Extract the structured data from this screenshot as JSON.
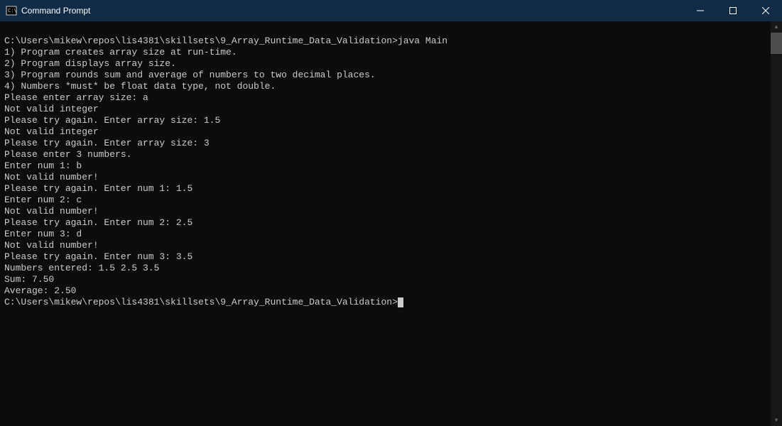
{
  "window": {
    "title": "Command Prompt"
  },
  "terminal": {
    "lines": [
      "C:\\Users\\mikew\\repos\\lis4381\\skillsets\\9_Array_Runtime_Data_Validation>java Main",
      "1) Program creates array size at run-time.",
      "2) Program displays array size.",
      "3) Program rounds sum and average of numbers to two decimal places.",
      "4) Numbers *must* be float data type, not double.",
      "",
      "Please enter array size: a",
      "Not valid integer",
      "",
      "Please try again. Enter array size: 1.5",
      "Not valid integer",
      "",
      "Please try again. Enter array size: 3",
      "",
      "Please enter 3 numbers.",
      "Enter num 1: b",
      "Not valid number!",
      "Please try again. Enter num 1: 1.5",
      "Enter num 2: c",
      "Not valid number!",
      "Please try again. Enter num 2: 2.5",
      "Enter num 3: d",
      "Not valid number!",
      "Please try again. Enter num 3: 3.5",
      "",
      "Numbers entered: 1.5 2.5 3.5",
      "Sum: 7.50",
      "Average: 2.50",
      "",
      "C:\\Users\\mikew\\repos\\lis4381\\skillsets\\9_Array_Runtime_Data_Validation>"
    ]
  }
}
